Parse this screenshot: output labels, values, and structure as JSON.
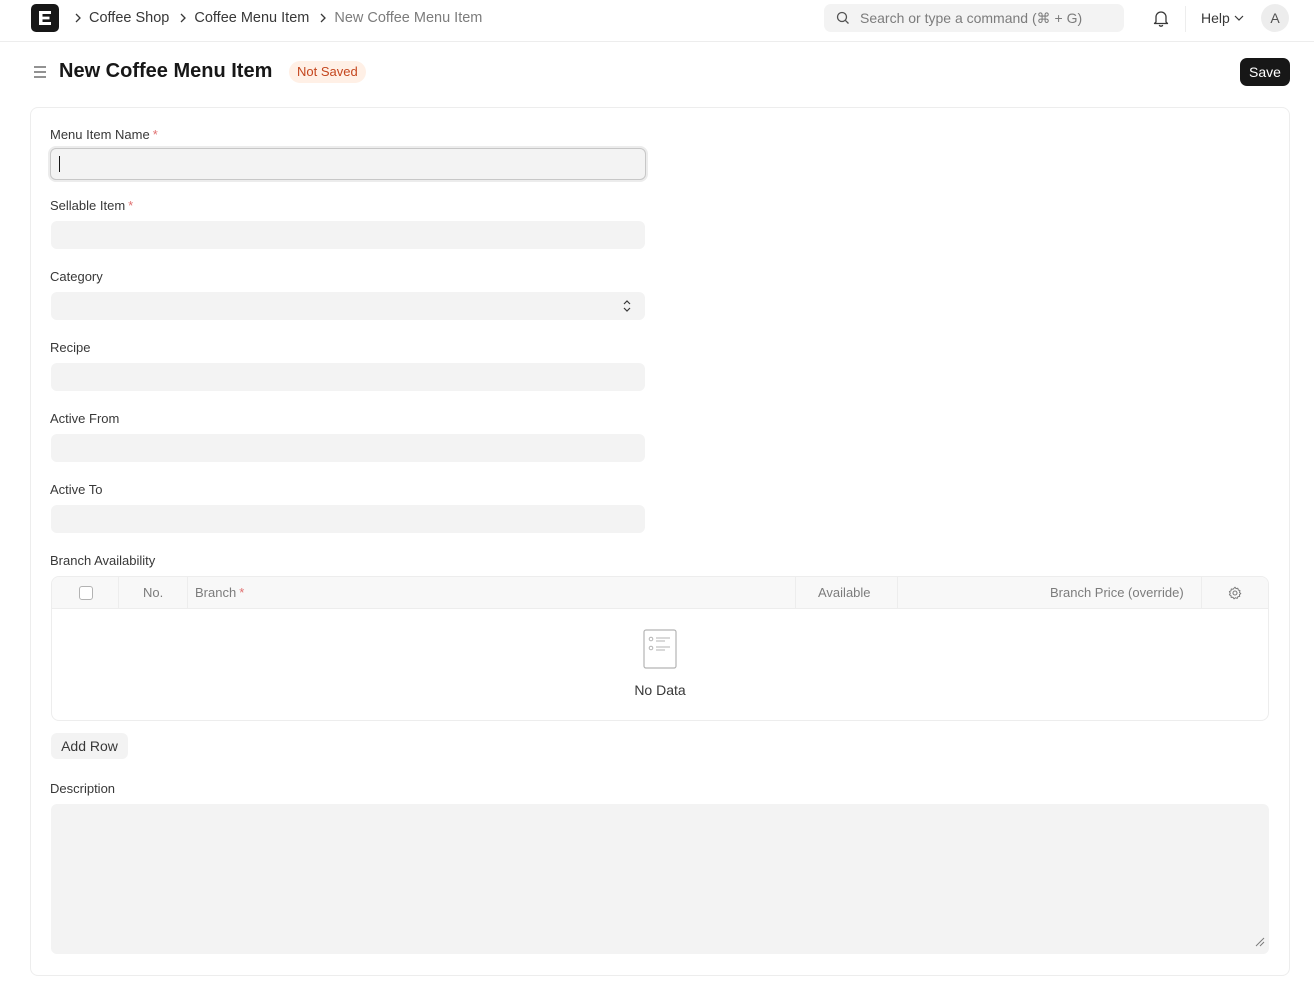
{
  "navbar": {
    "logo_letter": "E",
    "breadcrumbs": [
      "Coffee Shop",
      "Coffee Menu Item",
      "New Coffee Menu Item"
    ],
    "search_placeholder": "Search or type a command (⌘ + G)",
    "help_label": "Help",
    "avatar_initial": "A"
  },
  "page": {
    "title": "New Coffee Menu Item",
    "status_badge": "Not Saved",
    "save_label": "Save"
  },
  "form": {
    "fields": {
      "menu_item_name": {
        "label": "Menu Item Name",
        "required": "*",
        "value": ""
      },
      "sellable_item": {
        "label": "Sellable Item",
        "required": "*",
        "value": ""
      },
      "category": {
        "label": "Category",
        "value": ""
      },
      "recipe": {
        "label": "Recipe",
        "value": ""
      },
      "active_from": {
        "label": "Active From",
        "value": ""
      },
      "active_to": {
        "label": "Active To",
        "value": ""
      }
    },
    "branch_availability": {
      "label": "Branch Availability",
      "columns": {
        "no": "No.",
        "branch": "Branch",
        "branch_required": "*",
        "available": "Available",
        "price": "Branch Price (override)"
      },
      "rows": [],
      "empty_text": "No Data",
      "add_row_label": "Add Row"
    },
    "description": {
      "label": "Description",
      "value": ""
    }
  },
  "colors": {
    "accent": "#171717",
    "badge_bg": "#fff0e6",
    "badge_text": "#c4461e",
    "input_bg": "#f3f3f3"
  }
}
